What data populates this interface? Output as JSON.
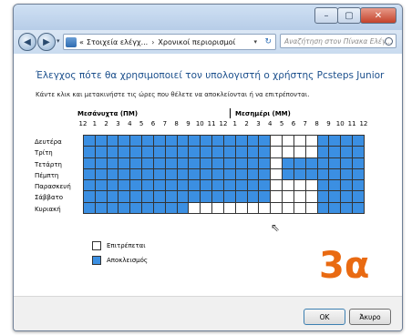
{
  "window": {
    "controls": {
      "minimize": "–",
      "maximize": "▢",
      "close": "✕"
    }
  },
  "nav": {
    "back_glyph": "◀",
    "forward_glyph": "▶",
    "dropdown_glyph": "▾",
    "address_prefix": "«",
    "breadcrumb": [
      "Στοιχεία ελέγχ...",
      "Χρονικοί περιορισμοί"
    ],
    "breadcrumb_sep": "›",
    "refresh_glyph": "↻",
    "search_placeholder": "Αναζήτηση στον Πίνακα Ελέγ..."
  },
  "content": {
    "heading": "Έλεγχος πότε θα χρησιμοποιεί τον υπολογιστή ο χρήστης Pcsteps Junior",
    "instruction": "Κάντε κλικ και μετακινήστε τις ώρες που θέλετε να αποκλείονται ή να επιτρέπονται.",
    "am_label": "Μεσάνυχτα (ΠΜ)",
    "pm_label": "Μεσημέρι (ΜΜ)",
    "hours": [
      "12",
      "1",
      "2",
      "3",
      "4",
      "5",
      "6",
      "7",
      "8",
      "9",
      "10",
      "11",
      "12",
      "1",
      "2",
      "3",
      "4",
      "5",
      "6",
      "7",
      "8",
      "9",
      "10",
      "11",
      "12"
    ],
    "days": [
      "Δευτέρα",
      "Τρίτη",
      "Τετάρτη",
      "Πέμπτη",
      "Παρασκευή",
      "Σάββατο",
      "Κυριακή"
    ]
  },
  "schedule": {
    "blocked_hours": [
      [
        0,
        1,
        2,
        3,
        4,
        5,
        6,
        7,
        8,
        9,
        10,
        11,
        12,
        13,
        14,
        15,
        20,
        21,
        22,
        23
      ],
      [
        0,
        1,
        2,
        3,
        4,
        5,
        6,
        7,
        8,
        9,
        10,
        11,
        12,
        13,
        14,
        15,
        20,
        21,
        22,
        23
      ],
      [
        0,
        1,
        2,
        3,
        4,
        5,
        6,
        7,
        8,
        9,
        10,
        11,
        12,
        13,
        14,
        15,
        17,
        18,
        19,
        20,
        21,
        22,
        23
      ],
      [
        0,
        1,
        2,
        3,
        4,
        5,
        6,
        7,
        8,
        9,
        10,
        11,
        12,
        13,
        14,
        15,
        17,
        18,
        19,
        20,
        21,
        22,
        23
      ],
      [
        0,
        1,
        2,
        3,
        4,
        5,
        6,
        7,
        8,
        9,
        10,
        11,
        12,
        13,
        14,
        15,
        20,
        21,
        22,
        23
      ],
      [
        0,
        1,
        2,
        3,
        4,
        5,
        6,
        7,
        8,
        9,
        10,
        11,
        12,
        13,
        14,
        15,
        20,
        21,
        22,
        23
      ],
      [
        0,
        1,
        2,
        3,
        4,
        5,
        6,
        7,
        8,
        20,
        21,
        22,
        23
      ]
    ]
  },
  "legend": {
    "allowed": "Επιτρέπεται",
    "blocked": "Αποκλεισμός",
    "blocked_color": "#3b8fe2",
    "allowed_color": "#ffffff"
  },
  "overlay": {
    "badge": "3α",
    "badge_color": "#e96a12"
  },
  "buttons": {
    "ok": "OK",
    "cancel": "Άκυρο"
  }
}
